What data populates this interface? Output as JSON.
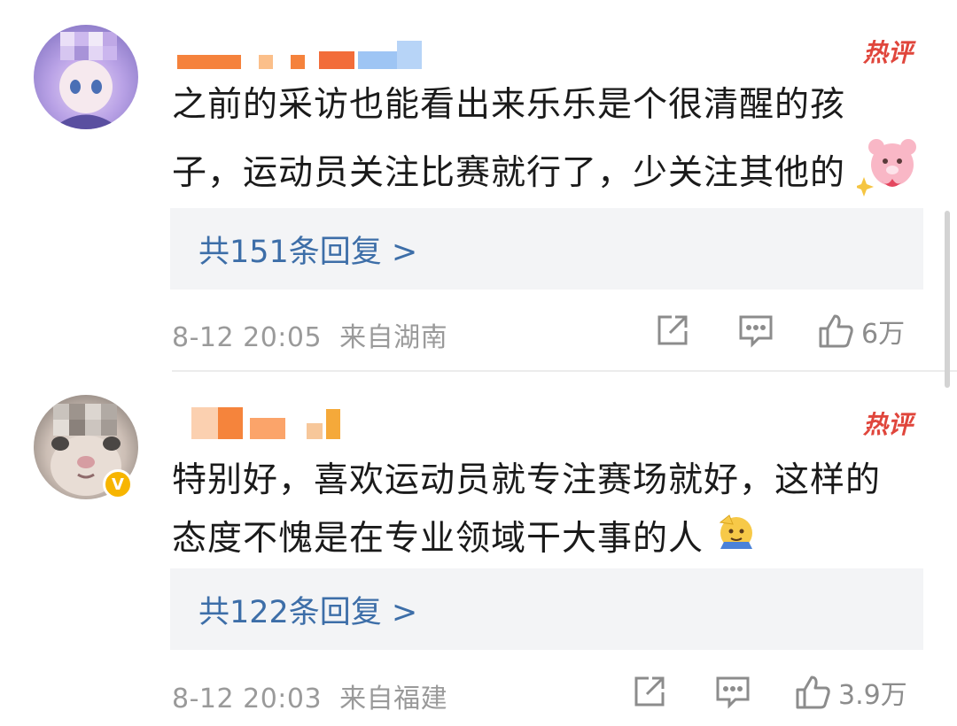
{
  "comments": [
    {
      "hot_label": "热评",
      "text_lines": [
        "之前的采访也能看出来乐乐是个很清醒的孩",
        "子，运动员关注比赛就行了，少关注其他的"
      ],
      "emoji": "pink-bear-sticker",
      "replies_label": "共151条回复 >",
      "time": "8-12 20:05",
      "location": "来自湖南",
      "likes": "6万",
      "verified": false
    },
    {
      "hot_label": "热评",
      "text_lines": [
        "特别好，喜欢运动员就专注赛场就好，这样的",
        "态度不愧是在专业领域干大事的人"
      ],
      "emoji": "salute-emoji",
      "replies_label": "共122条回复 >",
      "time": "8-12 20:03",
      "location": "来自福建",
      "likes": "3.9万",
      "verified": true,
      "verified_mark": "V"
    }
  ],
  "colors": {
    "link": "#3d6ea8",
    "hot": "#e0463c",
    "meta": "#9a9a9a",
    "reply_bg": "#f3f4f6",
    "verified": "#f7b500"
  },
  "icons": [
    "share-icon",
    "comment-icon",
    "like-icon"
  ]
}
